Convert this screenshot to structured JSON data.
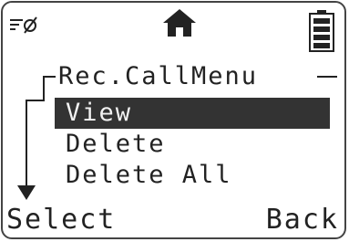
{
  "status": {
    "signal_icon": "no-signal-icon",
    "home_icon": "home-icon",
    "battery_icon": "battery-icon"
  },
  "menu": {
    "title": "Rec.CallMenu",
    "items": [
      {
        "label": "View",
        "selected": true
      },
      {
        "label": "Delete",
        "selected": false
      },
      {
        "label": "Delete All",
        "selected": false
      }
    ],
    "scroll_indicator": "down-arrow-icon"
  },
  "softkeys": {
    "left": "Select",
    "right": "Back"
  },
  "colors": {
    "foreground": "#222222",
    "highlight_bg": "#333333",
    "highlight_fg": "#f2f2f2",
    "background": "#ffffff"
  }
}
